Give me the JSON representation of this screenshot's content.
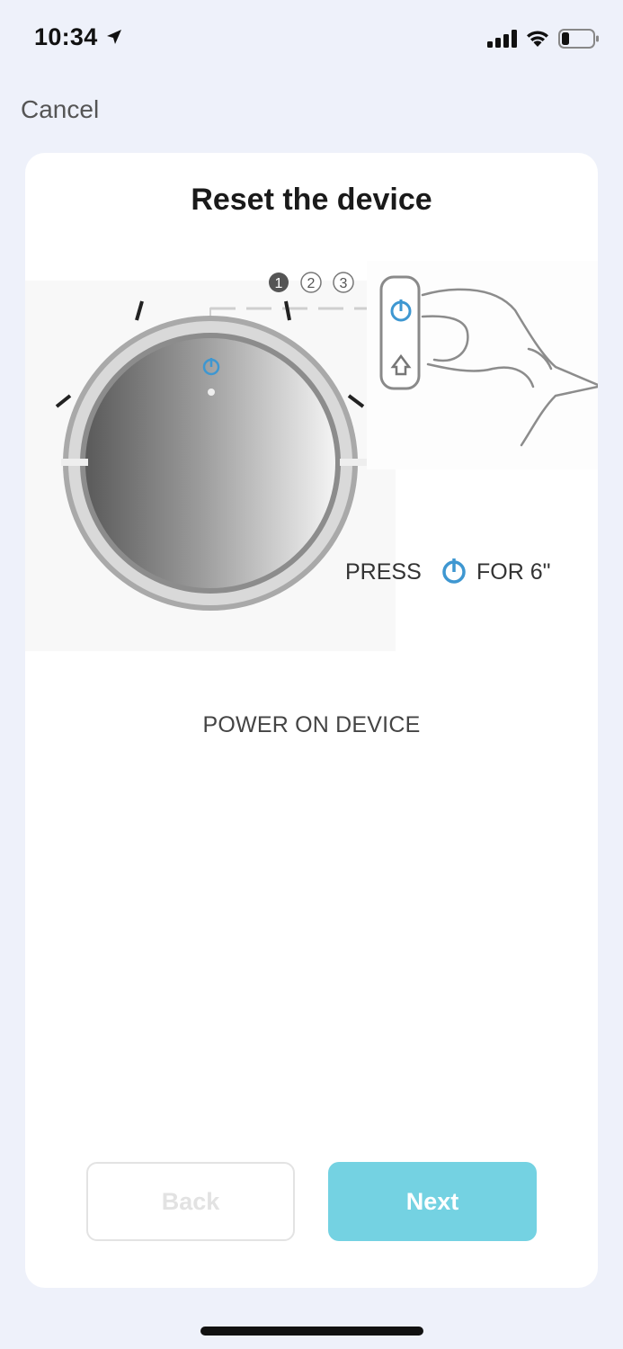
{
  "status_bar": {
    "time": "10:34"
  },
  "nav": {
    "cancel_label": "Cancel"
  },
  "card": {
    "title": "Reset the device",
    "illustration": {
      "step_numbers": [
        "1",
        "2",
        "3"
      ],
      "active_step": 1,
      "press_label_before": "PRESS",
      "press_label_after": "FOR 6\"",
      "accent_color": "#3e97d1"
    },
    "instruction": "POWER ON DEVICE"
  },
  "buttons": {
    "back_label": "Back",
    "next_label": "Next",
    "next_color": "#74d2e2"
  }
}
